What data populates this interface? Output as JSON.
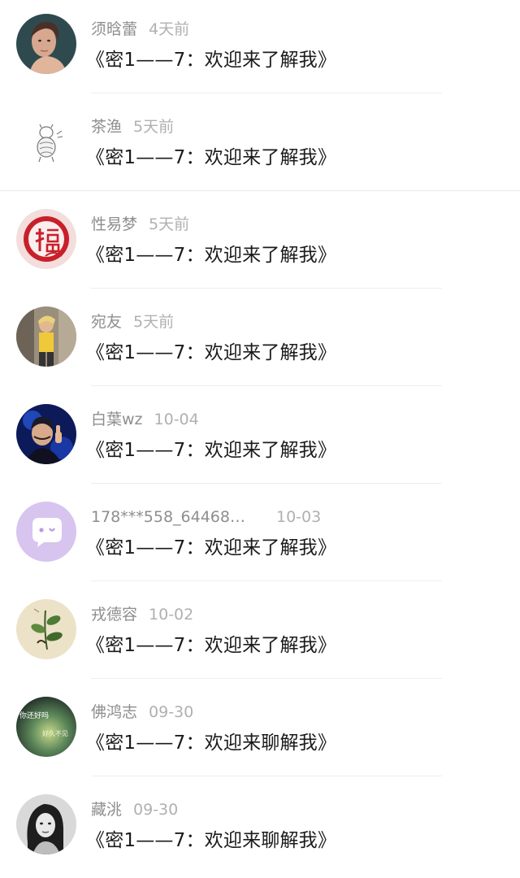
{
  "comments": [
    {
      "name": "须晗蕾",
      "time": "4天前",
      "message": "《密1——7：欢迎来了解我》",
      "avatar_icon": "woman-portrait-avatar"
    },
    {
      "name": "茶渔",
      "time": "5天前",
      "message": "《密1——7：欢迎来了解我》",
      "avatar_icon": "cartoon-sketch-avatar"
    },
    {
      "name": "性易梦",
      "time": "5天前",
      "message": "《密1——7：欢迎来了解我》",
      "avatar_icon": "fu-character-avatar"
    },
    {
      "name": "宛友",
      "time": "5天前",
      "message": "《密1——7：欢迎来了解我》",
      "avatar_icon": "street-photo-avatar"
    },
    {
      "name": "白葉wz",
      "time": "10-04",
      "message": "《密1——7：欢迎来了解我》",
      "avatar_icon": "gamer-thumbs-up-avatar"
    },
    {
      "name": "178***558_64468…",
      "time": "10-03",
      "message": "《密1——7：欢迎来了解我》",
      "avatar_icon": "chat-bubble-avatar"
    },
    {
      "name": "戎德容",
      "time": "10-02",
      "message": "《密1——7：欢迎来了解我》",
      "avatar_icon": "plant-illustration-avatar"
    },
    {
      "name": "佛鸿志",
      "time": "09-30",
      "message": "《密1——7：欢迎来聊解我》",
      "avatar_icon": "text-greeting-avatar",
      "avatar_text": [
        "你还好吗",
        "好久不见"
      ]
    },
    {
      "name": "藏洮",
      "time": "09-30",
      "message": "《密1——7：欢迎来聊解我》",
      "avatar_icon": "bw-portrait-avatar"
    }
  ],
  "colors": {
    "name": "#8e8e8e",
    "time": "#b0b0b0",
    "message": "#1b1b1b",
    "chat_avatar_bg": "#d7c4ef"
  }
}
